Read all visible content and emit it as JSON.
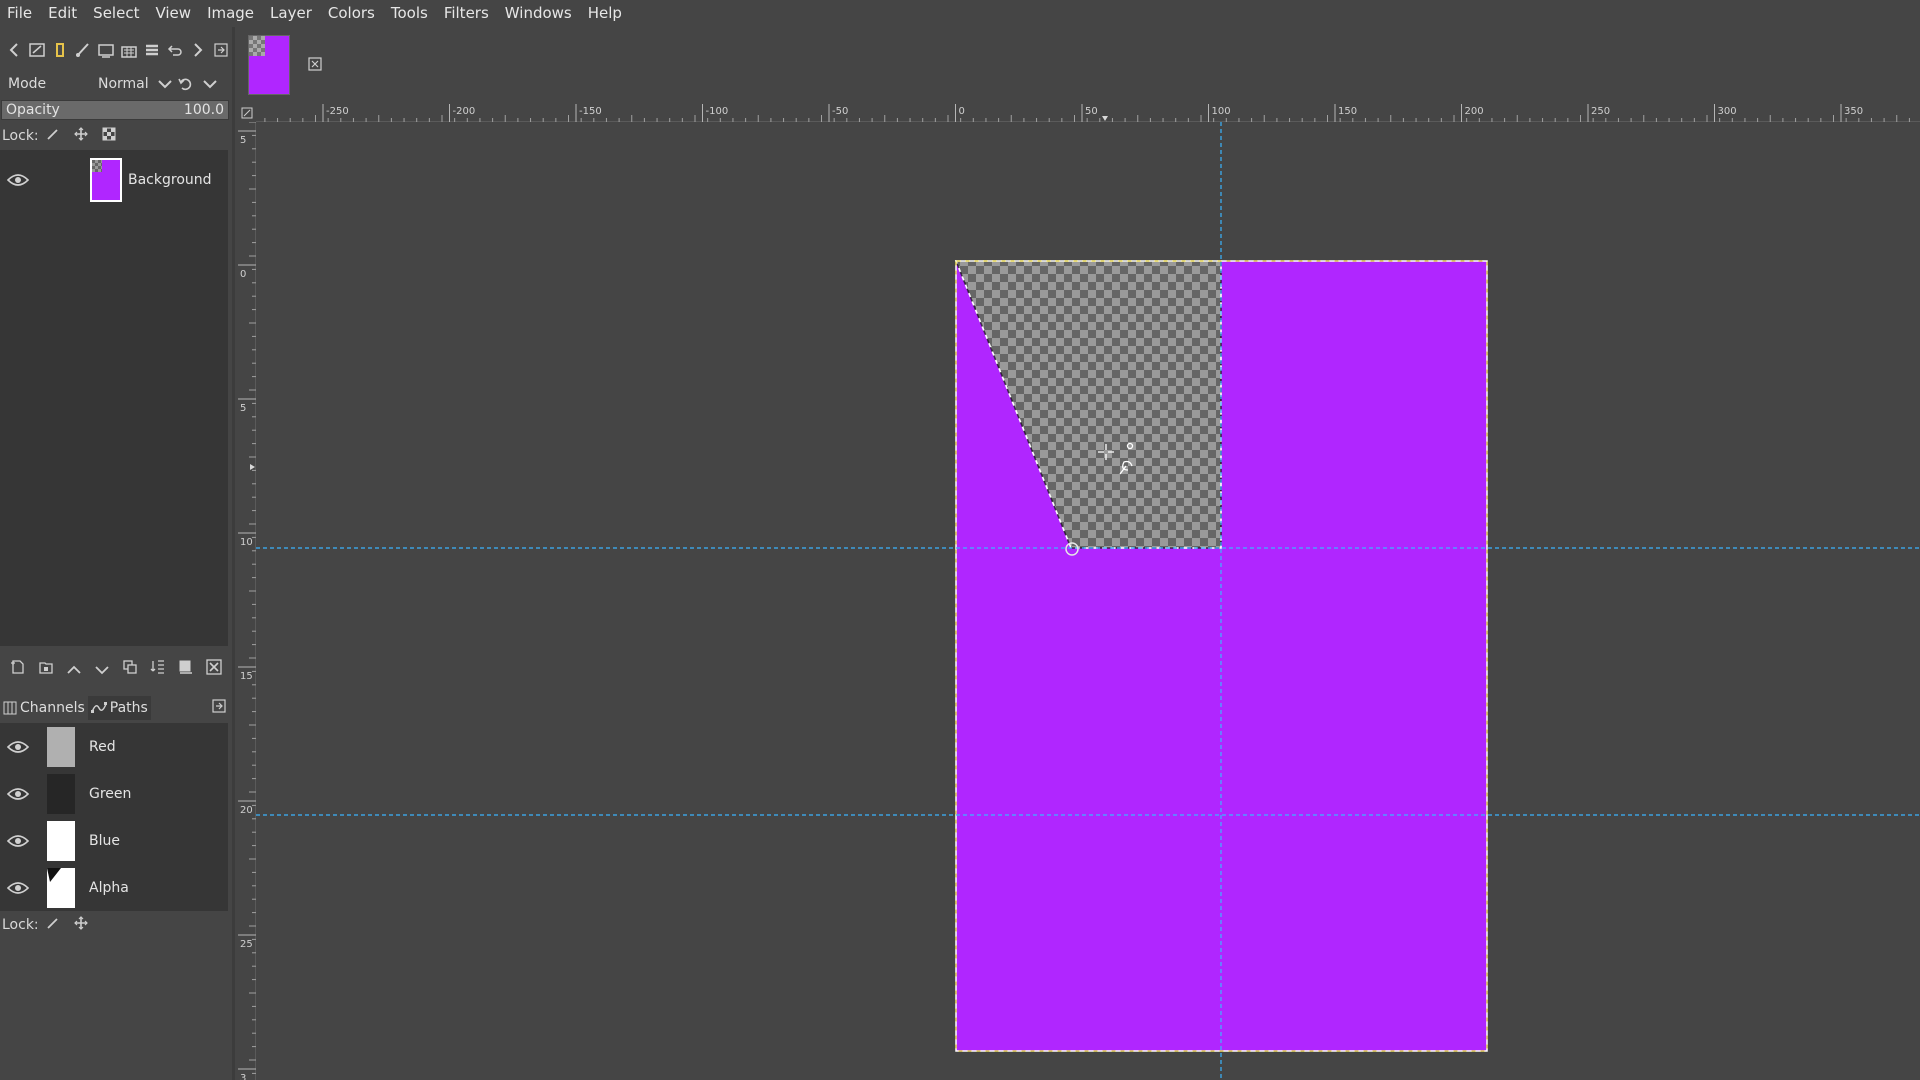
{
  "menubar": {
    "items": [
      "File",
      "Edit",
      "Select",
      "View",
      "Image",
      "Layer",
      "Colors",
      "Tools",
      "Filters",
      "Windows",
      "Help"
    ]
  },
  "dock_toolbar": {
    "icons": [
      "back-icon",
      "tool-options-icon",
      "devices-icon",
      "brushes-icon",
      "images-icon",
      "patterns-icon",
      "layers-icon",
      "undo-history-icon",
      "forward-icon",
      "dock-menu-icon"
    ]
  },
  "layers_panel": {
    "mode_label": "Mode",
    "mode_value": "Normal",
    "opacity_label": "Opacity",
    "opacity_value": "100.0",
    "opacity_percent": 100,
    "lock_label": "Lock:",
    "layers": [
      {
        "name": "Background",
        "visible": true,
        "thumb_color": "#b026ff"
      }
    ]
  },
  "tabs": [
    {
      "label": "Channels",
      "icon": "channels-icon",
      "active": false
    },
    {
      "label": "Paths",
      "icon": "paths-icon",
      "active": true
    }
  ],
  "channels": [
    {
      "name": "Red",
      "visible": true,
      "thumb_color": "#b0b0b0"
    },
    {
      "name": "Green",
      "visible": true,
      "thumb_color": "#262626"
    },
    {
      "name": "Blue",
      "visible": true,
      "thumb_color": "#ffffff"
    },
    {
      "name": "Alpha",
      "visible": true,
      "thumb_color": "#ffffff"
    }
  ],
  "channels_lock_label": "Lock:",
  "hruler": {
    "labels": [
      "-250",
      "-200",
      "-150",
      "-100",
      "-50",
      "0",
      "50",
      "100",
      "150",
      "200",
      "250",
      "300",
      "350"
    ]
  },
  "vruler": {
    "labels": [
      "5",
      "0",
      "5",
      "10",
      "15",
      "20",
      "25",
      "3"
    ]
  },
  "colors": {
    "image_fill": "#b026ff",
    "guide": "#3bb5ff",
    "canvas_bg": "#454545"
  }
}
